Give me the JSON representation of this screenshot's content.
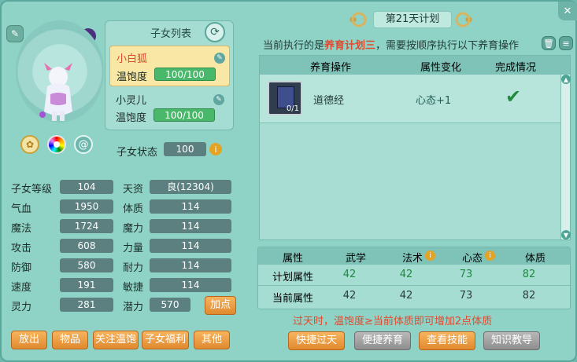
{
  "header": {
    "plan_title": "第21天计划"
  },
  "colors": {
    "accent": "#e04a2f",
    "panel": "#8fd3c6",
    "green": "#1f8a3c"
  },
  "child_list": {
    "title": "子女列表",
    "children": [
      {
        "name": "小白狐",
        "satiety_label": "温饱度",
        "satiety_value": "100/100",
        "selected": true
      },
      {
        "name": "小灵儿",
        "satiety_label": "温饱度",
        "satiety_value": "100/100",
        "selected": false
      }
    ]
  },
  "child_status": {
    "label": "子女状态",
    "value": "100"
  },
  "stats": [
    {
      "left_label": "子女等级",
      "left_value": "104",
      "right_label": "天资",
      "right_value": "良(12304)"
    },
    {
      "left_label": "气血",
      "left_value": "1950",
      "right_label": "体质",
      "right_value": "114"
    },
    {
      "left_label": "魔法",
      "left_value": "1724",
      "right_label": "魔力",
      "right_value": "114"
    },
    {
      "left_label": "攻击",
      "left_value": "608",
      "right_label": "力量",
      "right_value": "114"
    },
    {
      "left_label": "防御",
      "left_value": "580",
      "right_label": "耐力",
      "right_value": "114"
    },
    {
      "left_label": "速度",
      "left_value": "191",
      "right_label": "敏捷",
      "right_value": "114"
    },
    {
      "left_label": "灵力",
      "left_value": "281",
      "right_label": "潜力",
      "right_value": "570"
    }
  ],
  "add_points_label": "加点",
  "bottom_left_buttons": [
    "放出",
    "物品",
    "关注温饱",
    "子女福利",
    "其他"
  ],
  "plan_message": {
    "prefix": "当前执行的是",
    "highlight": "养育计划三",
    "suffix": "，需要按顺序执行以下养育操作"
  },
  "ops_table": {
    "headers": [
      "养育操作",
      "属性变化",
      "完成情况"
    ],
    "rows": [
      {
        "item_count": "0/1",
        "name": "道德经",
        "change": "心态+1",
        "done": true
      }
    ]
  },
  "attr_table": {
    "headers": [
      "属性",
      "武学",
      "法术",
      "心态",
      "体质"
    ],
    "rows": [
      {
        "label": "计划属性",
        "values": [
          "42",
          "42",
          "73",
          "82"
        ]
      },
      {
        "label": "当前属性",
        "values": [
          "42",
          "42",
          "73",
          "82"
        ]
      }
    ]
  },
  "footer_note": "过天时，温饱度≥当前体质即可增加2点体质",
  "bottom_right_buttons": [
    {
      "label": "快捷过天",
      "style": "orange"
    },
    {
      "label": "便捷养育",
      "style": "gray"
    },
    {
      "label": "查看技能",
      "style": "orange"
    },
    {
      "label": "知识教导",
      "style": "gray"
    }
  ]
}
